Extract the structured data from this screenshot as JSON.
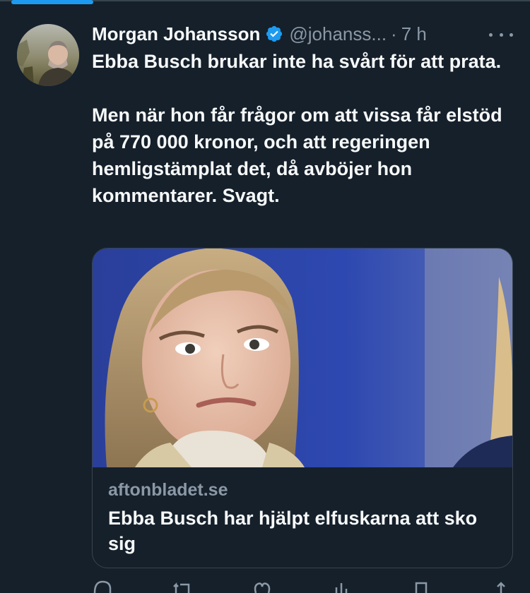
{
  "tweet": {
    "author": {
      "display_name": "Morgan Johansson",
      "handle": "@johanss...",
      "verified": true
    },
    "separator": "·",
    "timestamp": "7 h",
    "text_paragraph_1": "Ebba Busch brukar inte ha svårt för att prata.",
    "text_paragraph_2": "Men när hon får frågor om att vissa får elstöd på 770 000 kronor, och att regeringen hemligstämplat det, då avböjer hon kommentarer. Svagt.",
    "link_card": {
      "domain": "aftonbladet.se",
      "title": "Ebba Busch har hjälpt elfuskarna att sko sig"
    }
  },
  "colors": {
    "background": "#15202b",
    "accent": "#1d9bf0",
    "secondary_text": "#8b98a5",
    "border": "#38444d"
  },
  "icons": [
    "verified-badge-icon",
    "more-icon",
    "reply-icon",
    "retweet-icon",
    "like-icon",
    "views-icon",
    "bookmark-icon",
    "share-icon"
  ]
}
